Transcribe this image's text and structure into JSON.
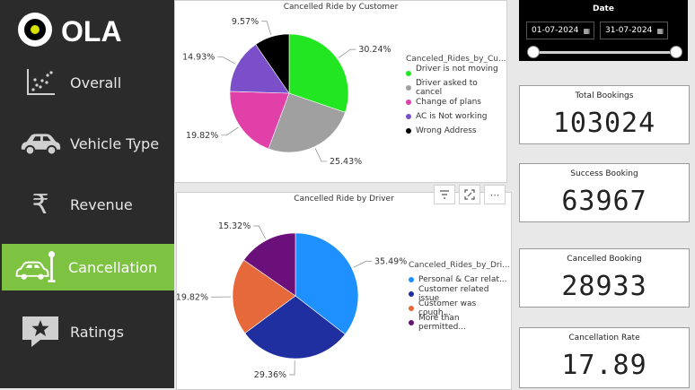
{
  "brand": {
    "name": "OLA"
  },
  "nav": {
    "items": [
      {
        "label": "Overall",
        "icon": "scatter-chart-icon"
      },
      {
        "label": "Vehicle Type",
        "icon": "car-icon"
      },
      {
        "label": "Revenue",
        "icon": "rupee-icon"
      },
      {
        "label": "Cancellation",
        "icon": "car-cancel-icon",
        "active": true
      },
      {
        "label": "Ratings",
        "icon": "star-comment-icon"
      }
    ],
    "active_color": "#7dc241"
  },
  "date_filter": {
    "title": "Date",
    "start": "01-07-2024",
    "end": "31-07-2024"
  },
  "cards": {
    "total": {
      "title": "Total Bookings",
      "value": "103024"
    },
    "success": {
      "title": "Success Booking",
      "value": "63967"
    },
    "cancelled": {
      "title": "Cancelled Booking",
      "value": "28933"
    },
    "rate": {
      "title": "Cancellation Rate",
      "value": "17.89"
    }
  },
  "chart_data": [
    {
      "type": "pie",
      "title": "Cancelled Ride by Customer",
      "legend_title": "Canceled_Rides_by_Cu...",
      "legend_position": "right",
      "series": [
        {
          "name": "Driver is not moving ...",
          "value": 30.24,
          "label": "30.24%",
          "color": "#22e622"
        },
        {
          "name": "Driver asked to cancel",
          "value": 25.43,
          "label": "25.43%",
          "color": "#a0a0a0"
        },
        {
          "name": "Change of plans",
          "value": 19.82,
          "label": "19.82%",
          "color": "#e040a8"
        },
        {
          "name": "AC is Not working",
          "value": 14.93,
          "label": "14.93%",
          "color": "#7b4fc9"
        },
        {
          "name": "Wrong Address",
          "value": 9.57,
          "label": "9.57%",
          "color": "#000000"
        }
      ]
    },
    {
      "type": "pie",
      "title": "Cancelled Ride by Driver",
      "legend_title": "Canceled_Rides_by_Dri...",
      "legend_position": "right",
      "series": [
        {
          "name": "Personal & Car relat...",
          "value": 35.49,
          "label": "35.49%",
          "color": "#1e90ff"
        },
        {
          "name": "Customer related issue",
          "value": 29.36,
          "label": "29.36%",
          "color": "#1f2f9f"
        },
        {
          "name": "Customer was cough...",
          "value": 19.82,
          "label": "19.82%",
          "color": "#e5693a"
        },
        {
          "name": "More than permitted...",
          "value": 15.32,
          "label": "15.32%",
          "color": "#6b0f7a"
        }
      ]
    }
  ]
}
